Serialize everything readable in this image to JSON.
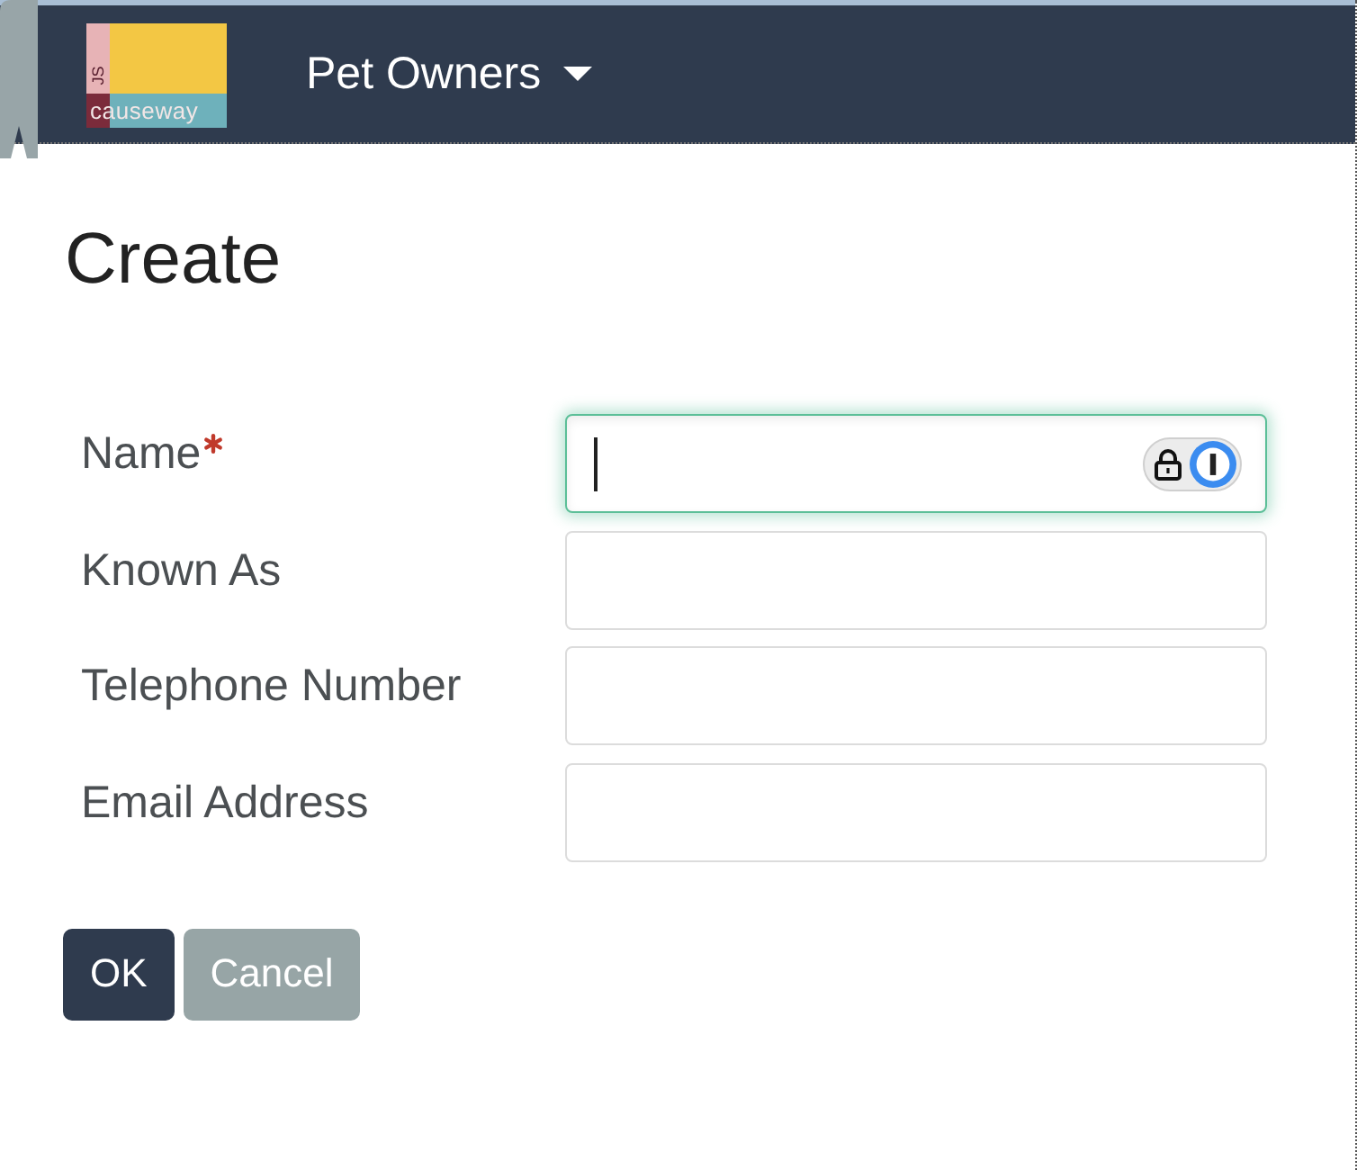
{
  "header": {
    "logo": {
      "mark": "JS",
      "text": "causeway"
    },
    "menu": {
      "label": "Pet Owners"
    }
  },
  "page": {
    "title": "Create"
  },
  "fields": [
    {
      "label": "Name",
      "required": true,
      "focused": true
    },
    {
      "label": "Known As",
      "required": false,
      "focused": false
    },
    {
      "label": "Telephone Number",
      "required": false,
      "focused": false
    },
    {
      "label": "Email Address",
      "required": false,
      "focused": false
    }
  ],
  "buttons": [
    {
      "label": "OK",
      "kind": "primary"
    },
    {
      "label": "Cancel",
      "kind": "secondary"
    }
  ]
}
